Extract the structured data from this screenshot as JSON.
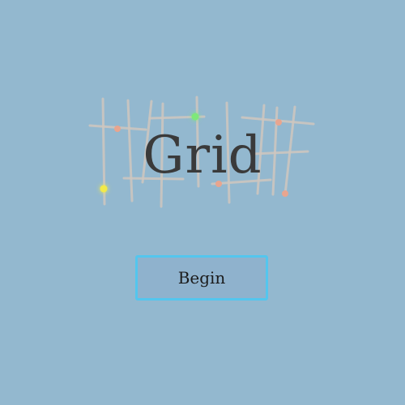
{
  "screen": "title",
  "title": {
    "text": "Grid",
    "color": "#3a3a3a"
  },
  "begin_button": {
    "label": "Begin",
    "border_color": "#53c6ee",
    "background": "#8fb2cd"
  },
  "background_color": "#93b8cf",
  "logo": {
    "line_color": "#cfc7bf",
    "node_colors": {
      "yellow": "#f2ea4a",
      "green": "#7ee87a",
      "salmon": "#e8a58f"
    }
  }
}
